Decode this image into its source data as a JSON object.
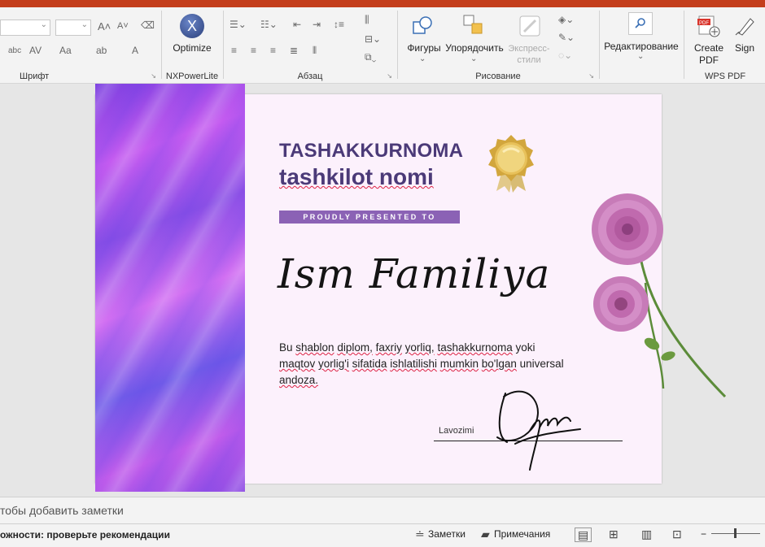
{
  "ribbon": {
    "groups": {
      "font": "Шрифт",
      "nxpower": "NXPowerLite",
      "paragraph": "Абзац",
      "drawing": "Рисование",
      "wps": "WPS PDF"
    },
    "buttons": {
      "optimize": "Optimize",
      "shapes": "Фигуры",
      "arrange": "Упорядочить",
      "express_styles": "Экспресс-стили",
      "editing": "Редактирование",
      "create_pdf": "Create PDF",
      "sign": "Sign"
    }
  },
  "slide": {
    "title": "TASHAKKURNOMA",
    "org": "tashkilot nomi",
    "presented": "PROUDLY PRESENTED TO",
    "recipient": "Ism Familiya",
    "body": {
      "p1": "Bu ",
      "w1": "shablon",
      "p2": " ",
      "w2": "diplom,",
      "p3": " ",
      "w3": "faxriy",
      "p4": " ",
      "w4": "yorliq,",
      "p5": " ",
      "w5": "tashakkurnoma",
      "p6": " yoki ",
      "w6": "maqtov",
      "p7": " ",
      "w7": "yorlig'i",
      "p8": " ",
      "w8": "sifatida",
      "p9": " ",
      "w9": "ishlatilishi",
      "p10": " ",
      "w10": "mumkin",
      "p11": " ",
      "w11": "bo'lgan",
      "p12": " universal ",
      "w12": "andoza."
    },
    "position_label": "Lavozimi"
  },
  "notes": {
    "placeholder": "тобы добавить заметки"
  },
  "status": {
    "accessibility": "ожности: проверьте рекомендации",
    "notes_btn": "Заметки",
    "comments_btn": "Примечания",
    "zoom_minus": "−"
  },
  "colors": {
    "accent": "#c43e1c",
    "title": "#4b3a78",
    "band": "#8b62b5"
  }
}
